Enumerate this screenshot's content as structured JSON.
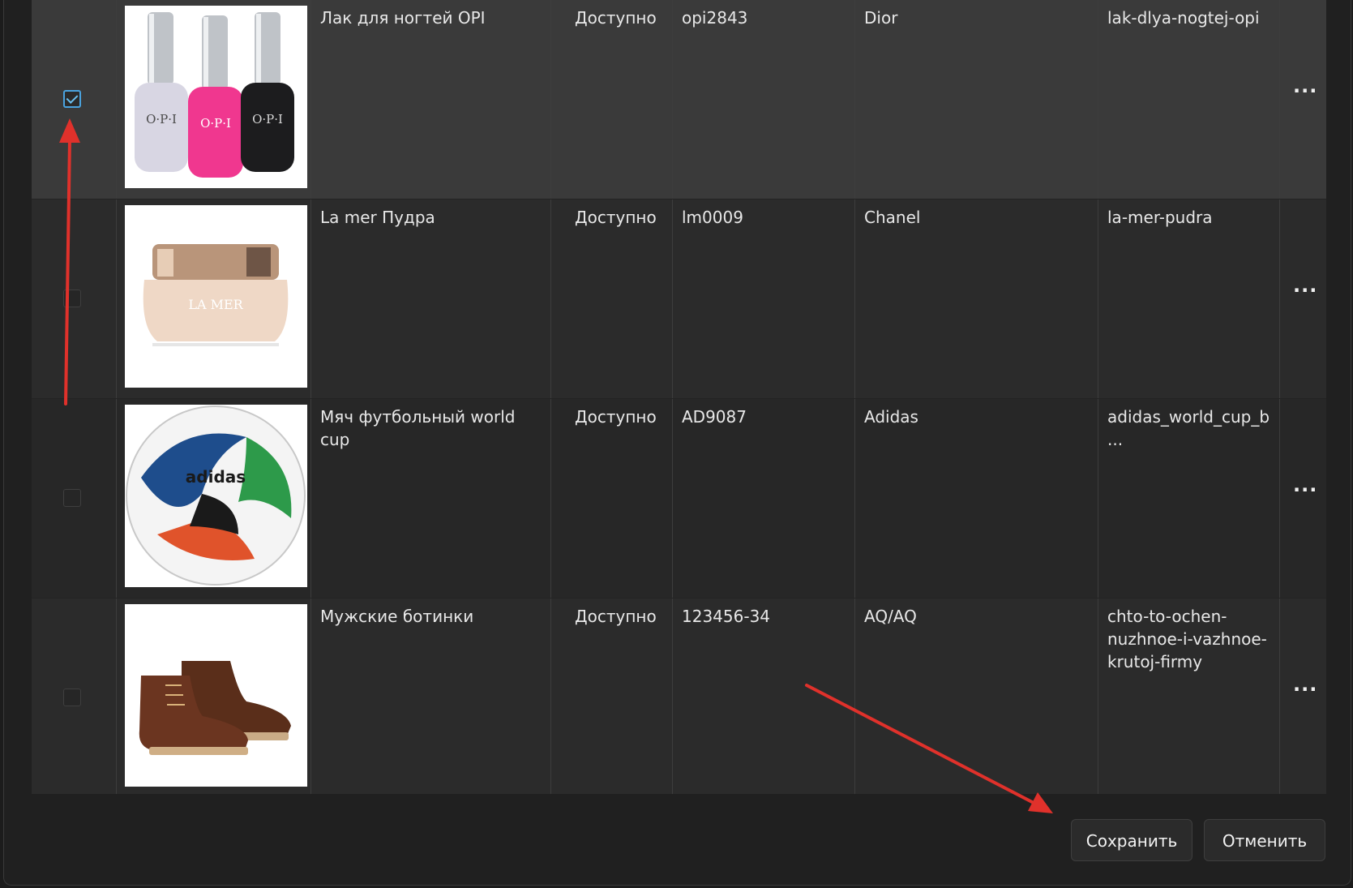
{
  "products": [
    {
      "checked": true,
      "image_icon": "nail-polish-bottles-image",
      "name": "Лак для ногтей OPI",
      "status": "Доступно",
      "sku": "opi2843",
      "brand": "Dior",
      "slug": "lak-dlya-nogtej-opi",
      "menu_label": "···"
    },
    {
      "checked": false,
      "image_icon": "face-powder-jar-image",
      "name": "La mer Пудра",
      "status": "Доступно",
      "sku": "lm0009",
      "brand": "Chanel",
      "slug": "la-mer-pudra",
      "menu_label": "···"
    },
    {
      "checked": false,
      "image_icon": "soccer-ball-image",
      "name": "Мяч футбольный world cup",
      "status": "Доступно",
      "sku": "AD9087",
      "brand": "Adidas",
      "slug": "adidas_world_cup_b...",
      "menu_label": "···"
    },
    {
      "checked": false,
      "image_icon": "mens-boots-image",
      "name": "Мужские ботинки",
      "status": "Доступно",
      "sku": "123456-34",
      "brand": "AQ/AQ",
      "slug": "chto-to-ochen-nuzhnoe-i-vazhnoe-krutoj-firmy",
      "menu_label": "···"
    }
  ],
  "image_text": {
    "opi": "O·P·I",
    "lamer": "LA MER",
    "adidas": "adidas"
  },
  "footer": {
    "save_label": "Сохранить",
    "cancel_label": "Отменить"
  },
  "colors": {
    "accent": "#4aa3df",
    "annotation_arrow": "#e0312b",
    "selected_row": "#3a3a3a"
  }
}
